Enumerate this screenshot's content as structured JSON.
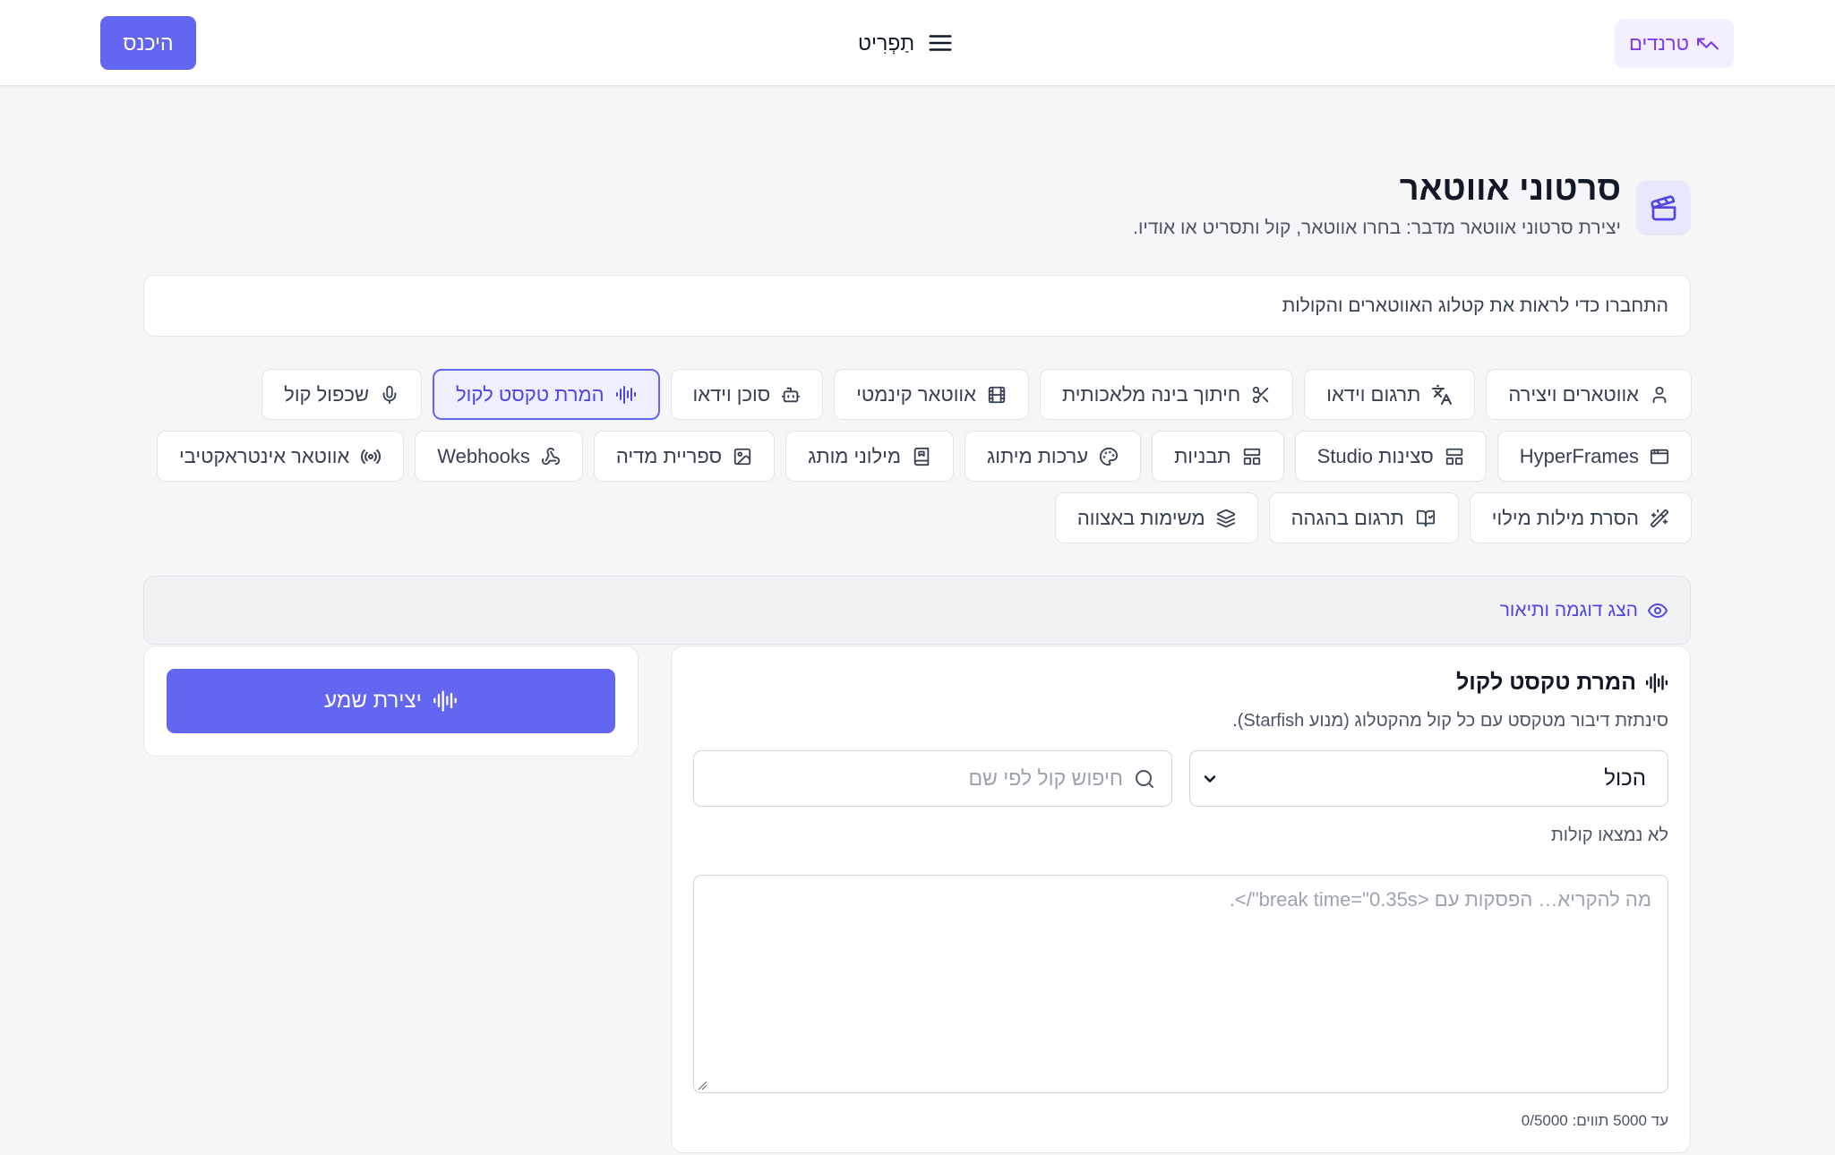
{
  "header": {
    "login_label": "היכנס",
    "menu_label": "תַפְרִיט",
    "trends_label": "טרנדים"
  },
  "page": {
    "title": "סרטוני אווטאר",
    "subtitle": "יצירת סרטוני אווטאר מדבר: בחרו אווטאר, קול ותסריט או אודיו.",
    "connect_prompt": "התחברו כדי לראות את קטלוג האווטארים והקולות"
  },
  "chips": {
    "row1": [
      {
        "label": "אווטארים ויצירה",
        "icon": "user-icon",
        "name": "avatars-creation"
      },
      {
        "label": "תרגום וידאו",
        "icon": "translate-icon",
        "name": "video-translation"
      },
      {
        "label": "חיתוך בינה מלאכותית",
        "icon": "scissors-icon",
        "name": "ai-clipping"
      },
      {
        "label": "אווטאר קינמטי",
        "icon": "film-icon",
        "name": "cinematic-avatar"
      },
      {
        "label": "סוכן וידאו",
        "icon": "bot-icon",
        "name": "video-agent"
      },
      {
        "label": "המרת טקסט לקול",
        "icon": "audio-wave-icon",
        "name": "text-to-speech",
        "active": true
      },
      {
        "label": "שכפול קול",
        "icon": "microphone-icon",
        "name": "voice-clone"
      }
    ],
    "row2": [
      {
        "label": "HyperFrames",
        "icon": "browser-window-icon",
        "name": "hyperframes"
      },
      {
        "label": "סצינות Studio",
        "icon": "layout-icon",
        "name": "studio-scenes"
      },
      {
        "label": "תבניות",
        "icon": "layout-icon",
        "name": "templates"
      },
      {
        "label": "ערכות מיתוג",
        "icon": "palette-icon",
        "name": "brand-kits"
      },
      {
        "label": "מילוני מותג",
        "icon": "book-icon",
        "name": "brand-glossaries"
      },
      {
        "label": "ספריית מדיה",
        "icon": "image-icon",
        "name": "media-library"
      },
      {
        "label": "Webhooks",
        "icon": "webhook-icon",
        "name": "webhooks"
      },
      {
        "label": "אווטאר אינטראקטיבי",
        "icon": "broadcast-icon",
        "name": "interactive-avatar"
      }
    ],
    "row3": [
      {
        "label": "הסרת מילות מילוי",
        "icon": "magic-wand-icon",
        "name": "filler-removal"
      },
      {
        "label": "תרגום בהגהה",
        "icon": "book-check-icon",
        "name": "proofread-translation"
      },
      {
        "label": "משימות באצווה",
        "icon": "layers-icon",
        "name": "batch-jobs"
      }
    ]
  },
  "demo": {
    "label": "הצג דוגמה ותיאור"
  },
  "generate": {
    "label": "יצירת שמע"
  },
  "tts": {
    "title": "המרת טקסט לקול",
    "description": "סינתזת דיבור מטקסט עם כל קול מהקטלוג (מנוע Starfish).",
    "filter_value": "הכול",
    "search_placeholder": "חיפוש קול לפי שם",
    "no_voices": "לא נמצאו קולות",
    "text_placeholder": "מה להקריא… הפסקות עם <break time=\"0.35s\"/>.",
    "counter": "עד 5000 תווים: 0/5000"
  },
  "colors": {
    "accent": "#6366f1",
    "trends_bg": "#f3efff",
    "trends_text": "#7c3aed"
  }
}
